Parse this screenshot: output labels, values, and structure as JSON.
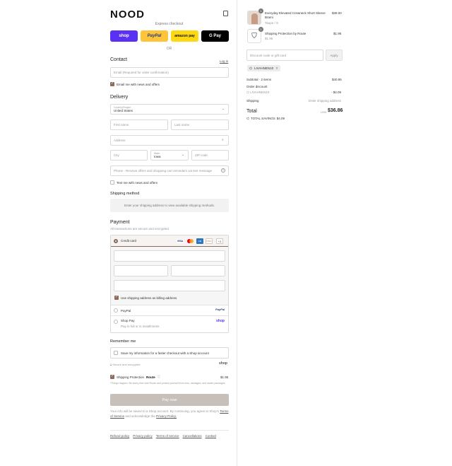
{
  "store": {
    "name": "NOOD"
  },
  "express": {
    "title": "Express checkout",
    "shop_label": "shop",
    "paypal_label": "PayPal",
    "amazon_label": "amazon pay",
    "gpay_label": "G Pay",
    "or_label": "OR"
  },
  "contact": {
    "heading": "Contact",
    "login_link": "Log in",
    "email_placeholder": "Email (Required for order confirmation)",
    "news_label": "Email me with news and offers"
  },
  "delivery": {
    "heading": "Delivery",
    "country_label": "Country/Region",
    "country_value": "United States",
    "first_name": "First name",
    "last_name": "Last name",
    "address": "Address",
    "city": "City",
    "state_label": "State",
    "state_value": "Iowa",
    "zip": "ZIP code",
    "phone": "Phone - Receive offers and shopping cart reminders via text message",
    "text_label": "Text me with news and offers"
  },
  "shipping": {
    "heading": "Shipping method",
    "placeholder": "Enter your shipping address to view available shipping methods."
  },
  "payment": {
    "heading": "Payment",
    "subtitle": "All transactions are secure and encrypted.",
    "credit_card": "Credit card",
    "card_more": "+3",
    "billing_label": "Use shipping address as billing address",
    "paypal": "PayPal",
    "paypal_logo": "PayPal",
    "shoppay": "Shop Pay",
    "shoppay_sub": "Pay in full or in installments",
    "shoppay_logo": "shop"
  },
  "remember": {
    "heading": "Remember me",
    "save_label": "Save my information for a faster checkout with a Shop account",
    "secure": "Secure and encrypted",
    "shop_logo": "shop"
  },
  "protection": {
    "label": "Shipping Protection",
    "brand": "Route",
    "price": "$1.95",
    "note": "*Things happen. Be worry-free with Route and protect yourself from loss, damaged, and stolen packages."
  },
  "pay_button": "Pay now",
  "legal": {
    "text1": "Your info will be saved to a Shop account. By continuing, you agree to Shop's",
    "terms": "Terms of Service",
    "and": "and acknowledge the",
    "privacy": "Privacy Policy."
  },
  "footer": [
    "Refund policy",
    "Privacy policy",
    "Terms of service",
    "Cancellations",
    "Contact"
  ],
  "cart": {
    "items": [
      {
        "qty": "1",
        "name": "Everyday Elevated Crewneck Short Sleeve Brami",
        "variant": "Taupe / S",
        "price": "$39.00"
      },
      {
        "qty": "1",
        "name": "Shipping Protection by Route",
        "variant": "$1.95",
        "price": "$1.95"
      }
    ],
    "discount_placeholder": "Discount code or gift card",
    "apply": "Apply",
    "code": "LIVAHNEN10",
    "subtotal_label": "Subtotal · 2 items",
    "subtotal_value": "$40.95",
    "order_discount": "Order discount",
    "discount_code": "LIVAHNEN10",
    "discount_value": "- $4.09",
    "shipping_label": "Shipping",
    "shipping_value": "Enter shipping address",
    "total_label": "Total",
    "currency": "USD",
    "total_value": "$36.86",
    "savings_label": "TOTAL SAVINGS",
    "savings_value": "$4.09"
  }
}
